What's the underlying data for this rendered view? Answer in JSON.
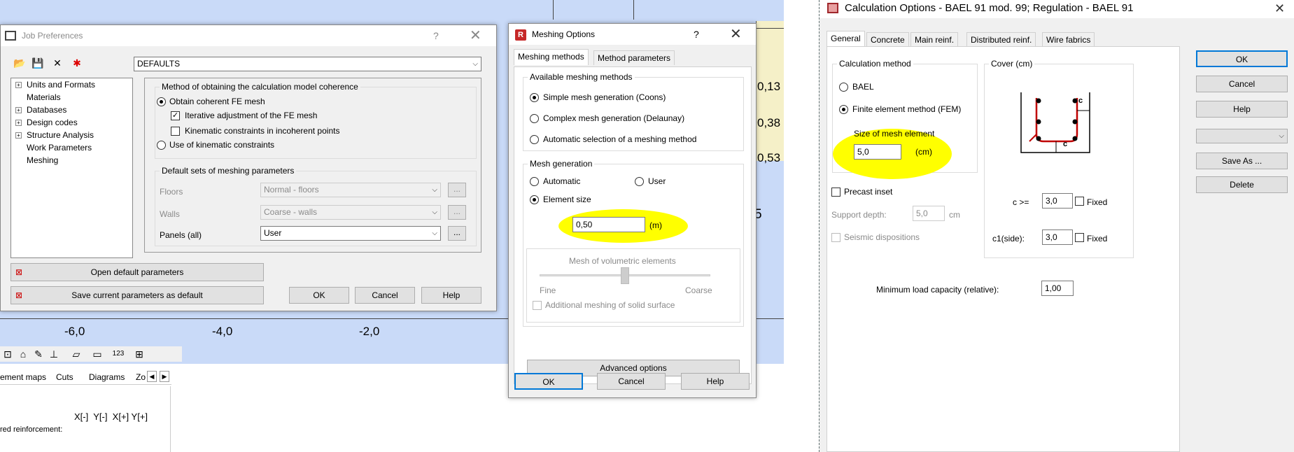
{
  "background": {
    "ruler": [
      "-6,0",
      "-4,0",
      "-2,0"
    ],
    "values": [
      "0,13",
      "0,38",
      "0,53",
      "5"
    ],
    "bottom_tabs": [
      "ement maps",
      "Cuts",
      "Diagrams",
      "Zo"
    ],
    "coords": "X[-]  Y[-]  X[+] Y[+]",
    "bottom_text": "red reinforcement:"
  },
  "job_prefs": {
    "title": "Job Preferences",
    "help": "?",
    "close": "✕",
    "combo_value": "DEFAULTS",
    "tree": [
      "Units and Formats",
      "Materials",
      "Databases",
      "Design codes",
      "Structure Analysis",
      "Work Parameters",
      "Meshing"
    ],
    "group1_label": "Method of obtaining the calculation model coherence",
    "radio_coherent": "Obtain coherent FE mesh",
    "chk_iterative": "Iterative adjustment of the FE mesh",
    "chk_kinematic": "Kinematic constraints in incoherent points",
    "radio_kinematic": "Use of kinematic constraints",
    "group2_label": "Default sets of meshing parameters",
    "floors_label": "Floors",
    "floors_value": "Normal - floors",
    "walls_label": "Walls",
    "walls_value": "Coarse - walls",
    "panels_label": "Panels (all)",
    "panels_value": "User",
    "dots": "...",
    "open_default": "Open default parameters",
    "save_default": "Save current parameters as default",
    "ok": "OK",
    "cancel": "Cancel",
    "help_btn": "Help"
  },
  "meshing": {
    "title": "Meshing Options",
    "help": "?",
    "close": "✕",
    "tabs": [
      "Meshing methods",
      "Method parameters"
    ],
    "avail_label": "Available meshing methods",
    "m1": "Simple mesh generation (Coons)",
    "m2": "Complex mesh generation (Delaunay)",
    "m3": "Automatic selection of a meshing method",
    "gen_label": "Mesh generation",
    "auto": "Automatic",
    "user": "User",
    "elem_size": "Element size",
    "size_value": "0,50",
    "unit": "(m)",
    "vol_label": "Mesh of volumetric elements",
    "fine": "Fine",
    "coarse": "Coarse",
    "additional": "Additional meshing of solid surface",
    "advanced": "Advanced options",
    "ok": "OK",
    "cancel": "Cancel",
    "help_btn": "Help"
  },
  "calc": {
    "title": "Calculation Options - BAEL 91 mod. 99;   Regulation - BAEL 91",
    "close": "✕",
    "tabs": [
      "General",
      "Concrete",
      "Main reinf.",
      "Distributed reinf.",
      "Wire fabrics"
    ],
    "method_label": "Calculation method",
    "bael": "BAEL",
    "fem": "Finite element method (FEM)",
    "size_label": "Size of mesh element",
    "size_value": "5,0",
    "size_unit": "(cm)",
    "cover_label": "Cover (cm)",
    "c_lbl": "c",
    "c1_lbl": "c",
    "precast": "Precast inset",
    "support_label": "Support depth:",
    "support_value": "5,0",
    "support_unit": "cm",
    "seismic": "Seismic dispositions",
    "c_ge": "c >=",
    "c_value": "3,0",
    "fixed": "Fixed",
    "c1_side": "c1(side):",
    "c1_value": "3,0",
    "min_load": "Minimum load capacity (relative):",
    "min_load_value": "1,00",
    "ok": "OK",
    "cancel": "Cancel",
    "help_btn": "Help",
    "save_as": "Save As ...",
    "delete": "Delete"
  },
  "colors": {
    "accent": "#0078d7",
    "highlight": "#ffff00",
    "canvas": "#c9daf8",
    "rebar": "#c00000"
  }
}
